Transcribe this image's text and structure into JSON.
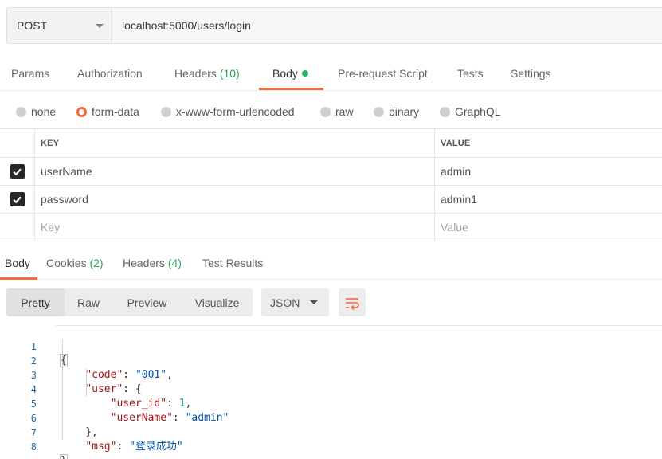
{
  "request": {
    "method": "POST",
    "url": "localhost:5000/users/login"
  },
  "request_tabs": [
    {
      "label": "Params"
    },
    {
      "label": "Authorization"
    },
    {
      "label": "Headers",
      "count": "(10)"
    },
    {
      "label": "Body",
      "active": true
    },
    {
      "label": "Pre-request Script"
    },
    {
      "label": "Tests"
    },
    {
      "label": "Settings"
    }
  ],
  "body_types": [
    {
      "label": "none",
      "selected": false
    },
    {
      "label": "form-data",
      "selected": true
    },
    {
      "label": "x-www-form-urlencoded",
      "selected": false
    },
    {
      "label": "raw",
      "selected": false
    },
    {
      "label": "binary",
      "selected": false
    },
    {
      "label": "GraphQL",
      "selected": false
    }
  ],
  "form_table": {
    "headers": {
      "key": "KEY",
      "value": "VALUE"
    },
    "rows": [
      {
        "checked": true,
        "key": "userName",
        "value": "admin"
      },
      {
        "checked": true,
        "key": "password",
        "value": "admin1"
      }
    ],
    "placeholder": {
      "key": "Key",
      "value": "Value"
    }
  },
  "response_tabs": [
    {
      "label": "Body",
      "active": true
    },
    {
      "label": "Cookies",
      "count": "(2)"
    },
    {
      "label": "Headers",
      "count": "(4)"
    },
    {
      "label": "Test Results"
    }
  ],
  "view_modes": [
    "Pretty",
    "Raw",
    "Preview",
    "Visualize"
  ],
  "active_view_mode": "Pretty",
  "format": "JSON",
  "response_json": {
    "line_numbers": [
      "1",
      "2",
      "3",
      "4",
      "5",
      "6",
      "7",
      "8"
    ],
    "open_brace": "{",
    "close_brace": "}",
    "code_key": "\"code\"",
    "code_value": "\"001\"",
    "user_key": "\"user\"",
    "user_id_key": "\"user_id\"",
    "user_id_value": "1",
    "user_name_key": "\"userName\"",
    "user_name_value": "\"admin\"",
    "msg_key": "\"msg\"",
    "msg_value": "\"登录成功\""
  },
  "colors": {
    "accent": "#f26b3a",
    "count_green": "#26a65b",
    "active_dot": "#26b565"
  },
  "icons": {
    "method_dropdown": "chevron-down-icon",
    "checkbox": "check-icon",
    "wrap": "wrap-lines-icon",
    "format_dropdown": "chevron-down-icon"
  }
}
